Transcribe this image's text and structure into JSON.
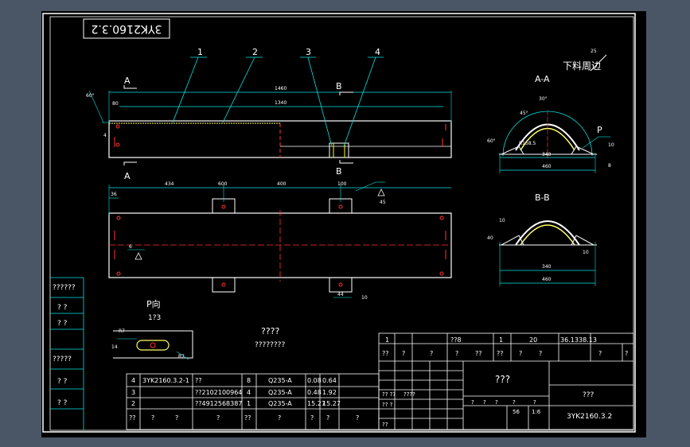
{
  "drawing_number_box": "3YK2160.3.2",
  "callouts": [
    "1",
    "2",
    "3",
    "4"
  ],
  "section_markers": {
    "a_top": "A",
    "a_bottom": "A",
    "b_top": "B",
    "b_bottom": "B"
  },
  "top_view": {
    "overall_dim": "1460",
    "inner_dim": "1340",
    "left_offset": "80",
    "angle_label": "60°",
    "side_dim": "4"
  },
  "plan_view": {
    "dims": [
      "434",
      "600",
      "400",
      "100"
    ],
    "left_dim": "36",
    "weld_note_right": "45",
    "weld_note_left": "6",
    "bracket_dims": [
      "44",
      "10"
    ]
  },
  "section_aa": {
    "title": "A-A",
    "angles": [
      "45°",
      "30°",
      "60°"
    ],
    "radius": "R158.5",
    "p_label": "P",
    "dims": [
      "340",
      "460"
    ],
    "side_dims": [
      "10",
      "8"
    ]
  },
  "section_bb": {
    "title": "B-B",
    "dims": [
      "340",
      "460"
    ],
    "side_dims": [
      "40",
      "10",
      "10"
    ]
  },
  "view_p": {
    "title": "P向",
    "scale": "1?3",
    "dims": [
      "R7",
      "14",
      "R7"
    ]
  },
  "surface_note": {
    "text": "下料周边",
    "value": "25"
  },
  "tech_requirements": {
    "title": "????",
    "body": "????????"
  },
  "bom": {
    "rows": [
      {
        "no": "4",
        "code": "3YK2160.3.2-1",
        "name": "??",
        "qty": "8",
        "mat": "Q235-A",
        "unit": "0.08",
        "total": "0.64"
      },
      {
        "no": "3",
        "code": "",
        "name": "??2102100964",
        "qty": "4",
        "mat": "Q235-A",
        "unit": "0.48",
        "total": "1.92"
      },
      {
        "no": "2",
        "code": "",
        "name": "??4912568387",
        "qty": "1",
        "mat": "Q235-A",
        "unit": "15.27",
        "total": "15.27"
      }
    ],
    "header": [
      "??",
      "?",
      "?",
      "?",
      "??",
      "?",
      "?",
      "?",
      "?"
    ]
  },
  "title_block": {
    "top_row": [
      "1",
      "??8",
      "1",
      "20",
      "36.13",
      "38.13"
    ],
    "top_row2": [
      "??",
      "?",
      "?",
      "?",
      "??",
      "??",
      "?",
      "?",
      "?",
      "?"
    ],
    "name": "???",
    "company": "???",
    "drawing_no": "3YK2160.3.2",
    "mid_rows": [
      "?? ??",
      "????",
      "?? ?"
    ],
    "scale_row": [
      "?",
      "?",
      "?",
      "?",
      "?"
    ],
    "scale_vals": [
      "56",
      "1:6"
    ],
    "left_labels": [
      "??"
    ]
  },
  "left_strip": [
    "??????",
    "?  ?",
    "?  ?",
    "?????",
    "?  ?",
    "?  ?"
  ]
}
